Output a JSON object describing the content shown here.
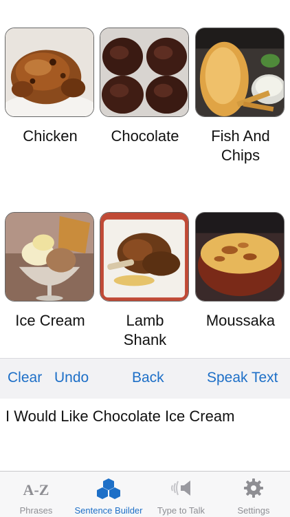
{
  "foods": [
    {
      "label": "Chicken",
      "image": "roast-chicken-photo"
    },
    {
      "label": "Chocolate",
      "image": "chocolate-truffles-photo"
    },
    {
      "label": "Fish And\nChips",
      "image": "fish-and-chips-photo"
    },
    {
      "label": "Ice Cream",
      "image": "ice-cream-sundae-photo"
    },
    {
      "label": "Lamb\nShank",
      "image": "lamb-shank-photo"
    },
    {
      "label": "Moussaka",
      "image": "moussaka-photo"
    }
  ],
  "toolbar": {
    "clear": "Clear",
    "undo": "Undo",
    "back": "Back",
    "speak": "Speak Text",
    "accent": "#1d6fc7"
  },
  "sentence": "I Would Like Chocolate Ice Cream",
  "tabs": [
    {
      "label": "Phrases",
      "icon": "a-z-icon",
      "glyph": "A-Z",
      "active": false
    },
    {
      "label": "Sentence Builder",
      "icon": "cubes-icon",
      "active": true
    },
    {
      "label": "Type to Talk",
      "icon": "speaker-icon",
      "active": false
    },
    {
      "label": "Settings",
      "icon": "gear-icon",
      "active": false
    }
  ]
}
